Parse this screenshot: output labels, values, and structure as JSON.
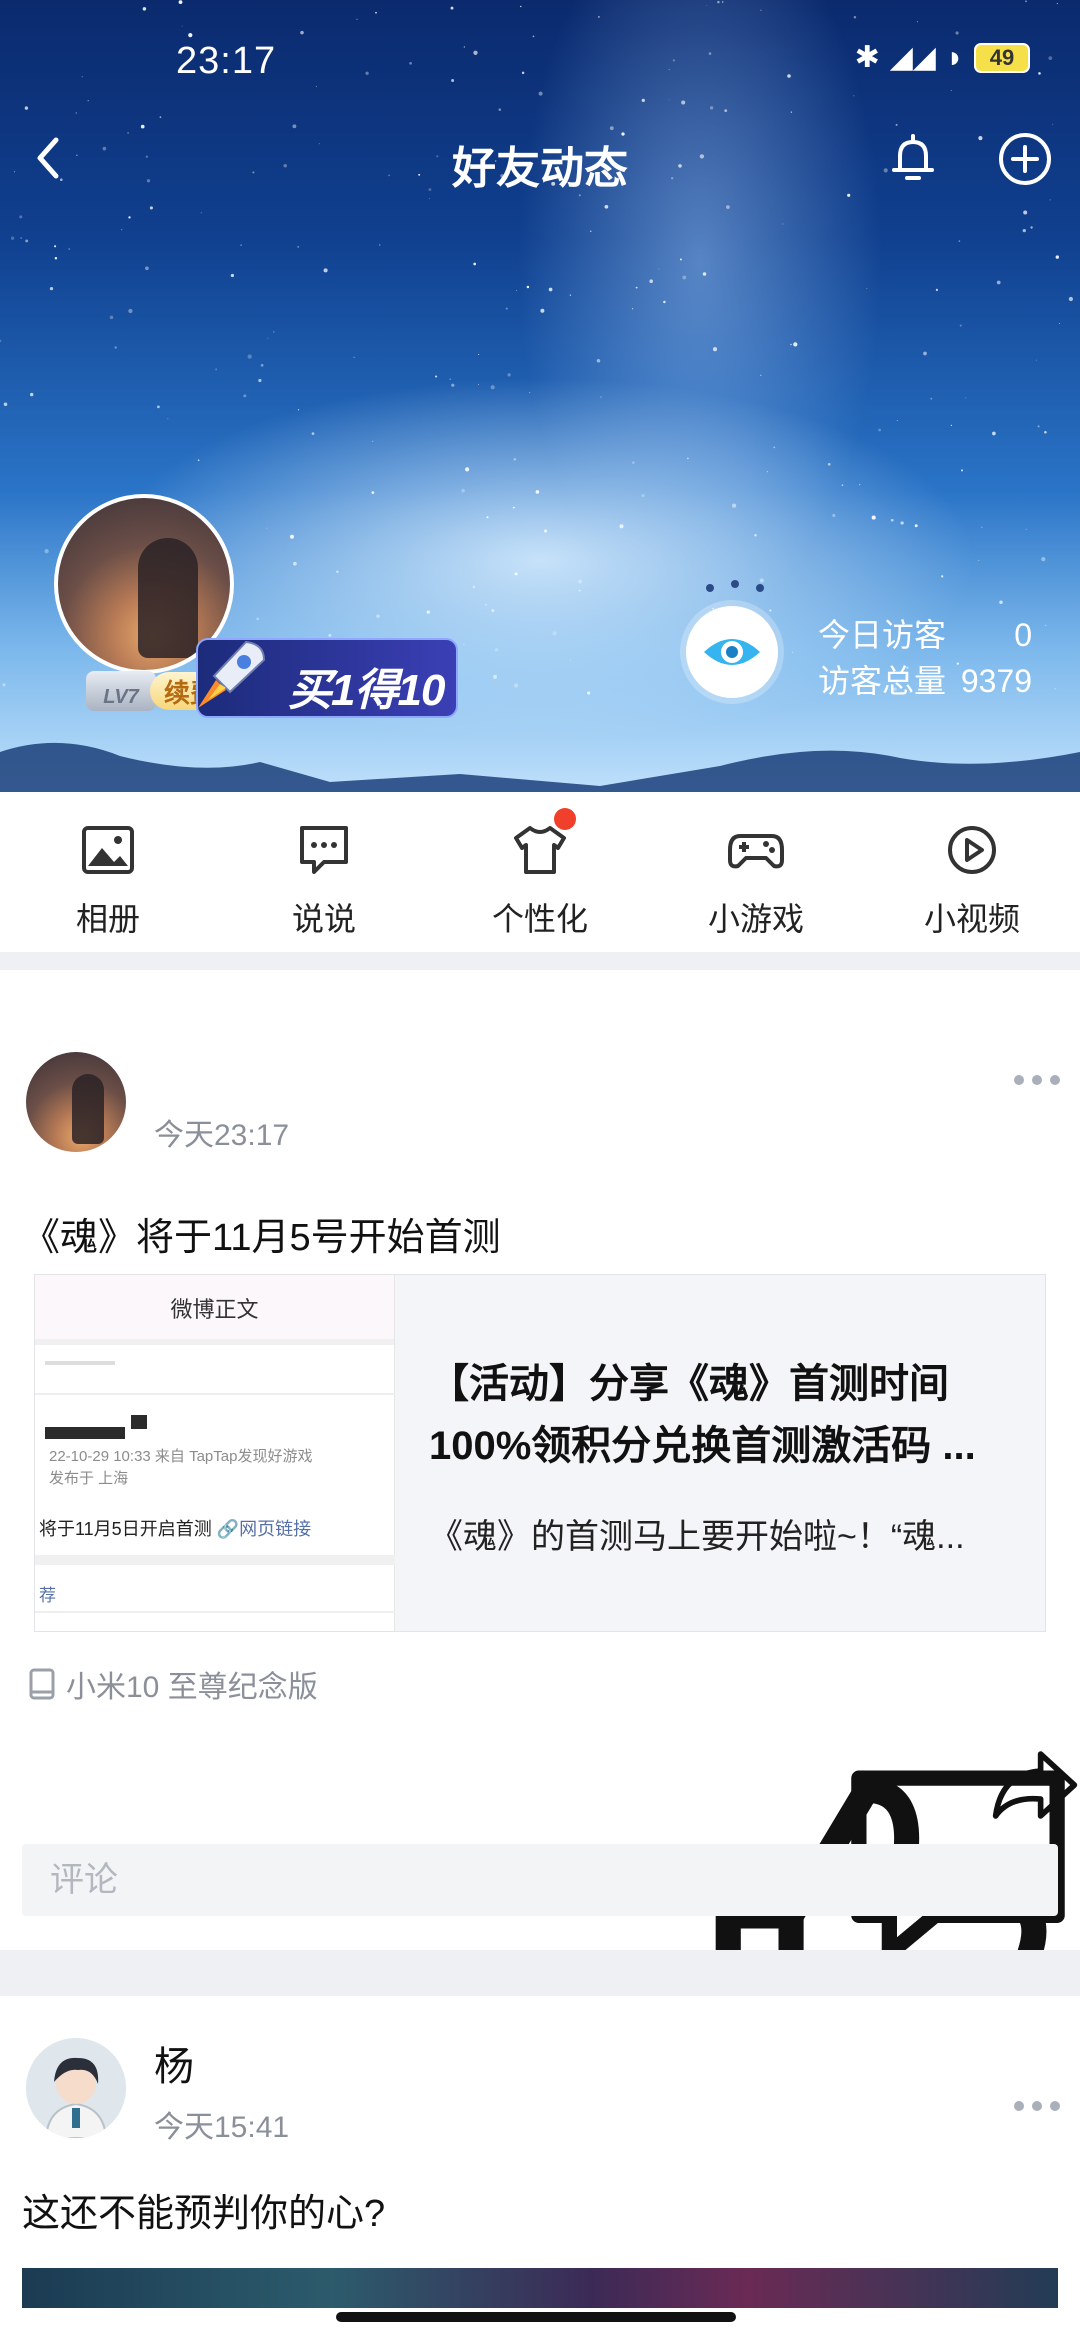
{
  "status_bar": {
    "time": "23:17",
    "battery": "49"
  },
  "nav": {
    "title": "好友动态"
  },
  "profile": {
    "level": "LV7",
    "renew_label": "续费",
    "promo_label": "买1得10",
    "visitors_today_label": "今日访客",
    "visitors_today_value": "0",
    "visitors_total_label": "访客总量",
    "visitors_total_value": "9379"
  },
  "features": [
    {
      "label": "相册",
      "icon": "photo-album-icon"
    },
    {
      "label": "说说",
      "icon": "chat-bubble-icon"
    },
    {
      "label": "个性化",
      "icon": "tshirt-icon"
    },
    {
      "label": "小游戏",
      "icon": "gamepad-icon"
    },
    {
      "label": "小视频",
      "icon": "play-icon"
    }
  ],
  "post1": {
    "time": "今天23:17",
    "text": "《魂》将于11月5号开始首测",
    "card": {
      "thumb_header": "微博正文",
      "thumb_meta": "22-10-29 10:33  来自 TapTap发现好游戏",
      "thumb_location": "发布于 上海",
      "thumb_line": "将于11月5日开启首测",
      "thumb_link": "网页链接",
      "thumb_footer": "荐",
      "title": "【活动】分享《魂》首测时间100%领积分兑换首测激活码 ...",
      "title_line1": "【活动】分享《魂》首测时间",
      "title_line2": "100%领积分兑换首测激活码 ...",
      "desc": "《魂》的首测马上要开始啦~！“魂..."
    },
    "device": "小米10 至尊纪念版",
    "comment_placeholder": "评论"
  },
  "post2": {
    "name": "杨",
    "time": "今天15:41",
    "text": "这还不能预判你的心?"
  },
  "colors": {
    "accent_red": "#f0402c",
    "muted_text": "#8a8f99",
    "link": "#5670a8"
  }
}
